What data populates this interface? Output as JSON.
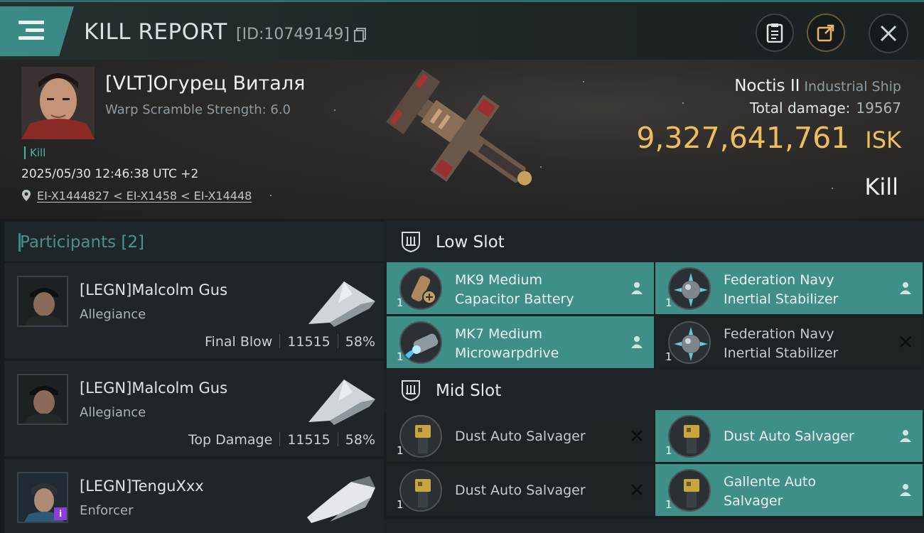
{
  "header": {
    "title": "KILL REPORT",
    "report_id": "[ID:10749149]"
  },
  "victim": {
    "name": "[VLT]Огурец Виталя",
    "warp_scramble": "Warp Scramble Strength: 6.0",
    "tag": "Kill",
    "datetime": "2025/05/30 12:46:38 UTC +2",
    "location": "EI-X1444827 < EI-X1458 < EI-X14448",
    "ship_name": "Noctis II",
    "ship_class": "Industrial Ship",
    "total_damage_label": "Total damage:",
    "total_damage": "19567",
    "isk_value": "9,327,641,761",
    "isk_unit": "ISK",
    "result": "Kill"
  },
  "participants": {
    "label": "Participants",
    "count": "[2]",
    "rows": [
      {
        "name": "[LEGN]Malcolm Gus",
        "ship": "Allegiance",
        "role": "Final Blow",
        "damage": "11515",
        "percent": "58%"
      },
      {
        "name": "[LEGN]Malcolm Gus",
        "ship": "Allegiance",
        "role": "Top Damage",
        "damage": "11515",
        "percent": "58%"
      },
      {
        "name": "[LEGN]TenguXxx",
        "ship": "Enforcer"
      }
    ]
  },
  "fittings": {
    "low_slot_label": "Low Slot",
    "mid_slot_label": "Mid Slot",
    "low": [
      {
        "name_line1": "MK9 Medium",
        "name_line2": "Capacitor Battery",
        "qty": "1",
        "status": "dropped"
      },
      {
        "name_line1": "Federation Navy",
        "name_line2": "Inertial Stabilizer",
        "qty": "1",
        "status": "dropped"
      },
      {
        "name_line1": "MK7 Medium",
        "name_line2": "Microwarpdrive",
        "qty": "1",
        "status": "dropped"
      },
      {
        "name_line1": "Federation Navy",
        "name_line2": "Inertial Stabilizer",
        "qty": "1",
        "status": "destroyed"
      }
    ],
    "mid": [
      {
        "name_line1": "Dust Auto Salvager",
        "name_line2": "",
        "qty": "1",
        "status": "destroyed"
      },
      {
        "name_line1": "Dust Auto Salvager",
        "name_line2": "",
        "qty": "1",
        "status": "dropped"
      },
      {
        "name_line1": "Dust Auto Salvager",
        "name_line2": "",
        "qty": "1",
        "status": "destroyed"
      },
      {
        "name_line1": "Gallente Auto",
        "name_line2": "Salvager",
        "qty": "1",
        "status": "dropped"
      }
    ]
  },
  "colors": {
    "accent_teal": "#3f8f89",
    "isk_gold": "#f0bd5c",
    "kill_tag": "#4fb0a6"
  },
  "icons": [
    "menu-icon",
    "copy-icon",
    "clipboard-icon",
    "share-icon",
    "close-icon",
    "location-pin-icon",
    "slot-icon",
    "pilot-icon",
    "cross-icon"
  ]
}
